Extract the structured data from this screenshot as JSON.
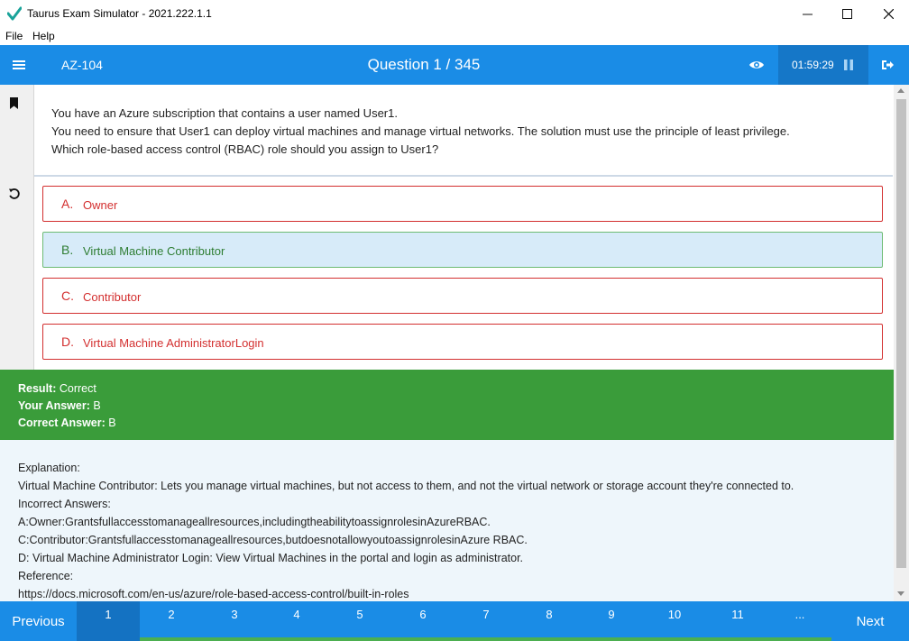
{
  "window": {
    "title": "Taurus Exam Simulator - 2021.222.1.1"
  },
  "menu": {
    "items": [
      "File",
      "Help"
    ]
  },
  "header": {
    "exam_code": "AZ-104",
    "question_title": "Question 1 / 345",
    "timer": "01:59:29",
    "icons": {
      "menu": "hamburger-icon",
      "reveal": "eye-icon",
      "pause": "pause-icon",
      "exit": "exit-icon"
    }
  },
  "question": {
    "lines": [
      "You have an Azure subscription that contains a user named User1.",
      "You need to ensure that User1 can deploy virtual machines and manage virtual networks. The solution must use the principle of least privilege.",
      "Which role-based access control (RBAC) role should you assign to User1?"
    ]
  },
  "options": [
    {
      "letter": "A.",
      "text": "Owner",
      "selected": false
    },
    {
      "letter": "B.",
      "text": "Virtual Machine Contributor",
      "selected": true
    },
    {
      "letter": "C.",
      "text": "Contributor",
      "selected": false
    },
    {
      "letter": "D.",
      "text": "Virtual Machine AdministratorLogin",
      "selected": false
    }
  ],
  "result": {
    "result_label": "Result:",
    "result_value": "Correct",
    "your_answer_label": "Your Answer:",
    "your_answer_value": "B",
    "correct_answer_label": "Correct Answer:",
    "correct_answer_value": "B"
  },
  "explanation": {
    "lines": [
      "Explanation:",
      "Virtual Machine Contributor: Lets you manage virtual machines, but not access to them, and not the virtual network or storage account they're connected to.",
      "Incorrect Answers:",
      "A:Owner:Grantsfullaccesstomanageallresources,includingtheabilitytoassignrolesinAzureRBAC.",
      "C:Contributor:Grantsfullaccesstomanageallresources,butdoesnotallowyoutoassignrolesinAzure RBAC.",
      "D: Virtual Machine Administrator Login: View Virtual Machines in the portal and login as administrator.",
      "Reference:",
      "https://docs.microsoft.com/en-us/azure/role-based-access-control/built-in-roles"
    ]
  },
  "footer": {
    "previous": "Previous",
    "next": "Next",
    "pages": [
      "1",
      "2",
      "3",
      "4",
      "5",
      "6",
      "7",
      "8",
      "9",
      "10",
      "11",
      "..."
    ],
    "current_page": "1"
  },
  "colors": {
    "header_blue": "#1a8ce6",
    "timer_blue": "#1577c8",
    "wrong_red": "#d32f2f",
    "correct_green": "#3a9c3a",
    "selected_bg": "#d7ebf9",
    "explanation_bg": "#eef6fb"
  }
}
